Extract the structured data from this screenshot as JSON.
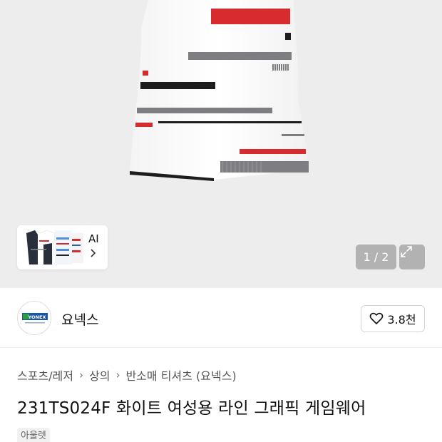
{
  "gallery": {
    "thumbnail_label": "AI",
    "pager_current": "1",
    "pager_total": "2",
    "pager_text": "1 / 2"
  },
  "brand": {
    "logo_text": "YONEX",
    "name": "요넥스",
    "like_count": "3.8천"
  },
  "breadcrumb": {
    "items": [
      "스포츠/레저",
      "상의",
      "반소매 티셔츠 (요넥스)"
    ]
  },
  "product": {
    "title": "231TS024F 화이트 여성용 라인 그래픽 게임웨어",
    "tag": "아울렛"
  },
  "colors": {
    "accent_red": "#d62b2f",
    "stripe_gray": "#7e7e82",
    "stripe_black": "#1d1d1d"
  }
}
